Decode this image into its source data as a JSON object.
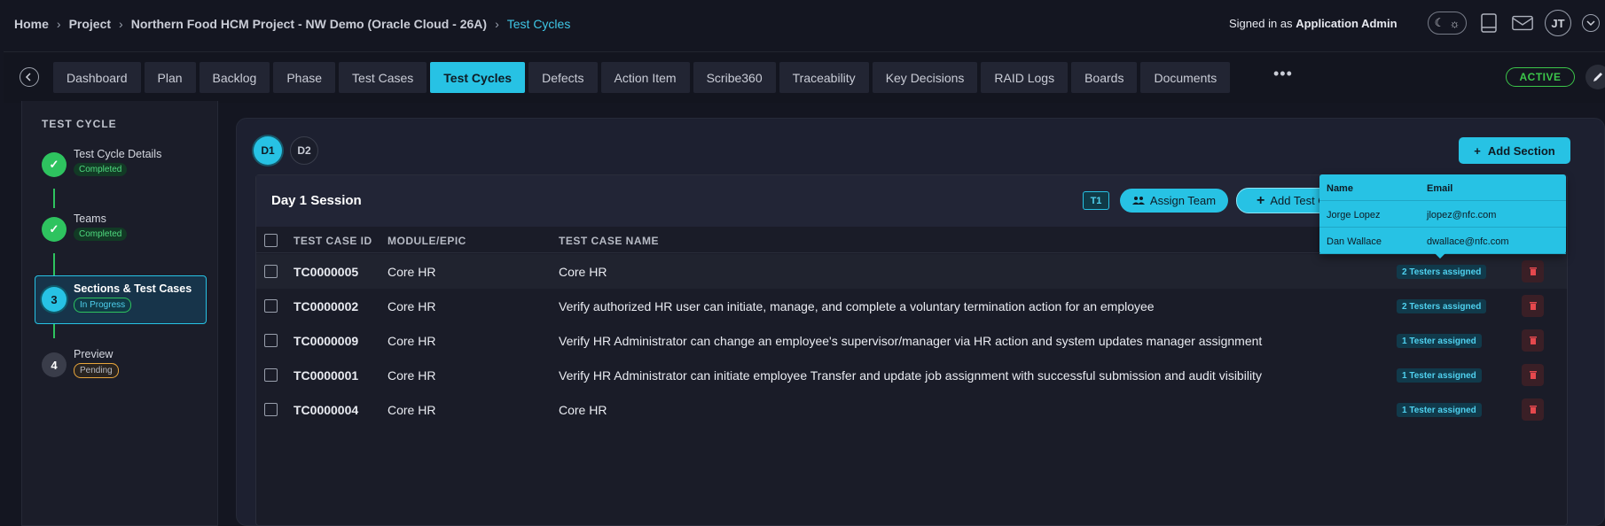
{
  "breadcrumb": {
    "items": [
      "Home",
      "Project",
      "Northern Food HCM Project - NW Demo (Oracle Cloud - 26A)"
    ],
    "current": "Test Cycles"
  },
  "user": {
    "signed_in_prefix": "Signed in as",
    "name": "Application Admin",
    "initials": "JT"
  },
  "tabs": [
    {
      "label": "Dashboard"
    },
    {
      "label": "Plan"
    },
    {
      "label": "Backlog"
    },
    {
      "label": "Phase"
    },
    {
      "label": "Test Cases"
    },
    {
      "label": "Test Cycles",
      "active": true
    },
    {
      "label": "Defects"
    },
    {
      "label": "Action Item"
    },
    {
      "label": "Scribe360"
    },
    {
      "label": "Traceability"
    },
    {
      "label": "Key Decisions"
    },
    {
      "label": "RAID Logs"
    },
    {
      "label": "Boards"
    },
    {
      "label": "Documents"
    }
  ],
  "status_badge": "ACTIVE",
  "sidebar": {
    "title": "TEST CYCLE",
    "steps": [
      {
        "title": "Test Cycle Details",
        "status": "Completed"
      },
      {
        "title": "Teams",
        "status": "Completed"
      },
      {
        "number": "3",
        "title": "Sections & Test Cases",
        "status": "In Progress"
      },
      {
        "number": "4",
        "title": "Preview",
        "status": "Pending"
      }
    ]
  },
  "days": [
    "D1",
    "D2"
  ],
  "add_section_label": "Add Section",
  "session": {
    "title": "Day 1 Session",
    "team_tag": "T1",
    "assign_team_label": "Assign Team",
    "add_test_label": "Add Test C"
  },
  "table": {
    "headers": {
      "id": "TEST CASE ID",
      "module": "MODULE/EPIC",
      "name": "TEST CASE NAME"
    },
    "rows": [
      {
        "id": "TC0000005",
        "module": "Core HR",
        "name": "Core HR",
        "testers": "2 Testers assigned"
      },
      {
        "id": "TC0000002",
        "module": "Core HR",
        "name": "Verify authorized HR user can initiate, manage, and complete a voluntary termination action for an employee",
        "testers": "2 Testers assigned"
      },
      {
        "id": "TC0000009",
        "module": "Core HR",
        "name": "Verify HR Administrator can change an employee's supervisor/manager via HR action and system updates manager assignment",
        "testers": "1 Tester assigned"
      },
      {
        "id": "TC0000001",
        "module": "Core HR",
        "name": "Verify HR Administrator can initiate employee Transfer and update job assignment with successful submission and audit visibility",
        "testers": "1 Tester assigned"
      },
      {
        "id": "TC0000004",
        "module": "Core HR",
        "name": "Core HR",
        "testers": "1 Tester assigned"
      }
    ]
  },
  "popover": {
    "headers": {
      "name": "Name",
      "email": "Email"
    },
    "rows": [
      {
        "name": "Jorge Lopez",
        "email": "jlopez@nfc.com"
      },
      {
        "name": "Dan Wallace",
        "email": "dwallace@nfc.com"
      }
    ]
  },
  "colors": {
    "accent": "#27c2e4",
    "success": "#2ec35f",
    "warning": "#e7a53c",
    "danger": "#e5484d"
  }
}
